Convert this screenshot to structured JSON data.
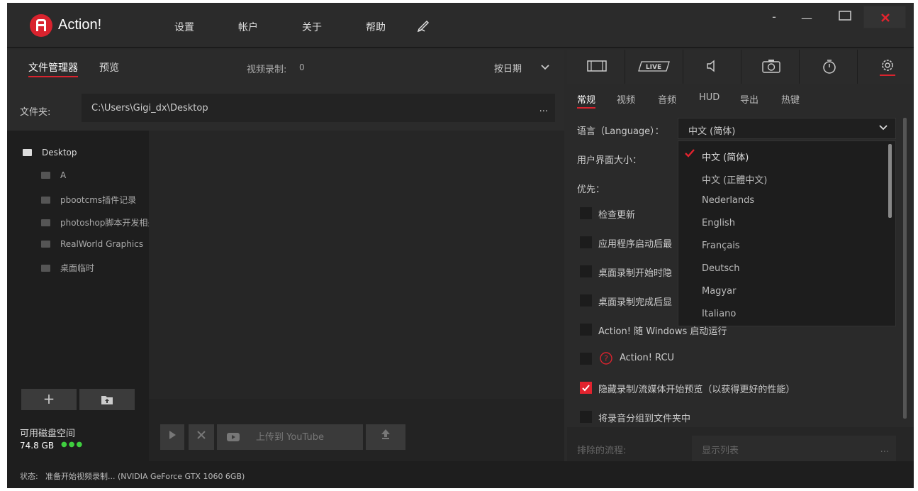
{
  "app": {
    "title": "Action!"
  },
  "menu": {
    "settings": "设置",
    "account": "帐户",
    "about": "关于",
    "help": "帮助"
  },
  "window": {
    "minimize": "-",
    "minimize2": "—"
  },
  "left": {
    "tabs": [
      "文件管理器",
      "预览"
    ],
    "recordings_label": "视频录制:",
    "recordings_count": "0",
    "sort_label": "按日期",
    "folder_label": "文件夹:",
    "folder_path": "C:\\Users\\Gigi_dx\\Desktop",
    "tree": [
      "Desktop",
      "A",
      "pbootcms插件记录",
      "photoshop脚本开发相关",
      "RealWorld Graphics",
      "桌面临时"
    ],
    "disk_label": "可用磁盘空间",
    "disk_value": "74.8 GB",
    "dots": "●●●",
    "upload_label": "上传到 YouTube"
  },
  "right": {
    "icon_tabs": [
      "film-icon",
      "live-icon",
      "audio-icon",
      "camera-icon",
      "timer-icon",
      "settings-gear-icon"
    ],
    "live_text": "LIVE",
    "sub_tabs": [
      "常规",
      "视频",
      "音频",
      "HUD",
      "导出",
      "热键"
    ],
    "language_label": "语言（Language）：",
    "language_value": "中文 (简体)",
    "ui_size_label": "用户界面大小：",
    "priority_label": "优先：",
    "checkboxes": [
      {
        "label": "检查更新",
        "checked": false
      },
      {
        "label": "应用程序启动后最",
        "checked": false
      },
      {
        "label": "桌面录制开始时隐",
        "checked": false
      },
      {
        "label": "桌面录制完成后显",
        "checked": false
      },
      {
        "label": "Action! 随 Windows 启动运行",
        "checked": false
      },
      {
        "label": "Action! RCU",
        "checked": false
      },
      {
        "label": "隐藏录制/流媒体开始预览（以获得更好的性能）",
        "checked": true
      },
      {
        "label": "将录音分组到文件夹中",
        "checked": false
      }
    ],
    "language_options": [
      "中文 (简体)",
      "中文 (正體中文)",
      "Nederlands",
      "English",
      "Français",
      "Deutsch",
      "Magyar",
      "Italiano"
    ],
    "exclude_label": "排除的流程:",
    "exclude_placeholder": "显示列表"
  },
  "status": {
    "label": "状态:",
    "text": "准备开始视频录制... (NVIDIA GeForce GTX 1060 6GB)"
  },
  "colors": {
    "accent": "#d9232e",
    "check_green": "#3fcf3f"
  }
}
